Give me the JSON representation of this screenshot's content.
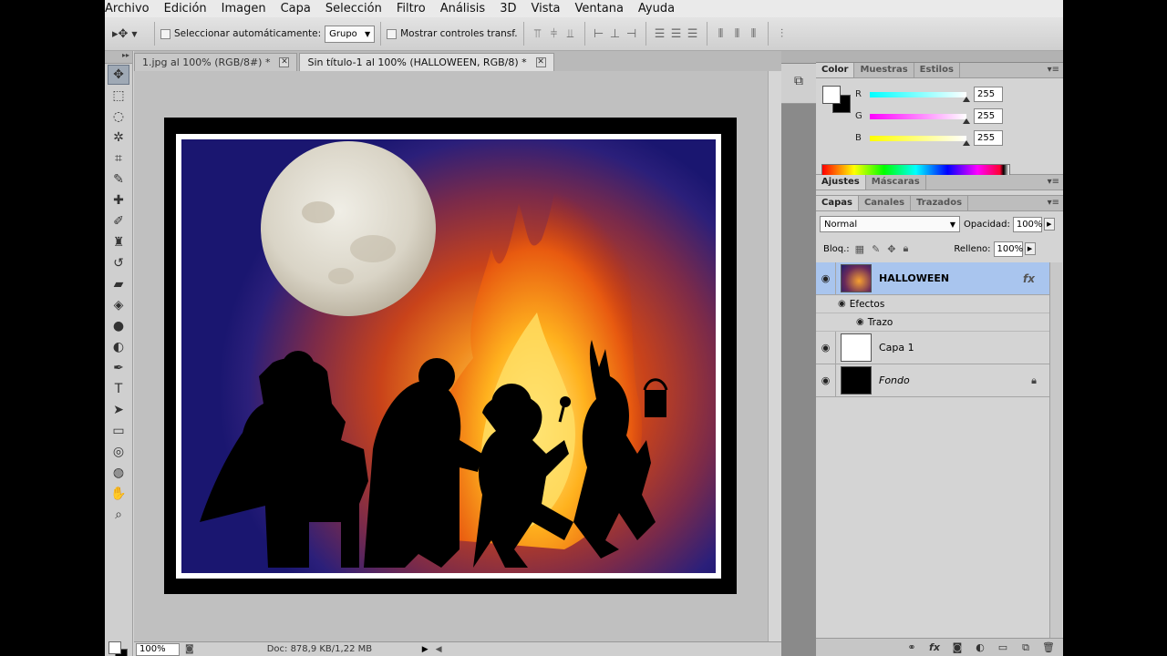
{
  "menu": [
    "Archivo",
    "Edición",
    "Imagen",
    "Capa",
    "Selección",
    "Filtro",
    "Análisis",
    "3D",
    "Vista",
    "Ventana",
    "Ayuda"
  ],
  "options": {
    "auto_select_label": "Seleccionar automáticamente:",
    "auto_select_value": "Grupo",
    "show_transform_label": "Mostrar controles transf."
  },
  "tabs": [
    {
      "label": "1.jpg al 100% (RGB/8#) *"
    },
    {
      "label": "Sin título-1 al 100% (HALLOWEEN, RGB/8) *"
    }
  ],
  "status": {
    "zoom": "100%",
    "doc_info": "Doc: 878,9 KB/1,22 MB"
  },
  "color_panel": {
    "tabs": [
      "Color",
      "Muestras",
      "Estilos"
    ],
    "channels": [
      {
        "label": "R",
        "value": "255",
        "gradient": "#00ffff"
      },
      {
        "label": "G",
        "value": "255",
        "gradient": "#ff00ff"
      },
      {
        "label": "B",
        "value": "255",
        "gradient": "#ffff00"
      }
    ],
    "foreground": "#ffffff",
    "background": "#000000"
  },
  "adjust_panel": {
    "tabs": [
      "Ajustes",
      "Máscaras"
    ]
  },
  "layers_panel": {
    "tabs": [
      "Capas",
      "Canales",
      "Trazados"
    ],
    "blend_mode": "Normal",
    "opacity_label": "Opacidad:",
    "opacity": "100%",
    "lock_label": "Bloq.:",
    "fill_label": "Relleno:",
    "fill": "100%",
    "layers": [
      {
        "name": "HALLOWEEN",
        "selected": true,
        "fx": "fx"
      },
      {
        "name": "Capa 1"
      },
      {
        "name": "Fondo",
        "locked": true
      }
    ],
    "effects_label": "Efectos",
    "effect_stroke": "Trazo"
  },
  "accent": "#a9c5ee"
}
